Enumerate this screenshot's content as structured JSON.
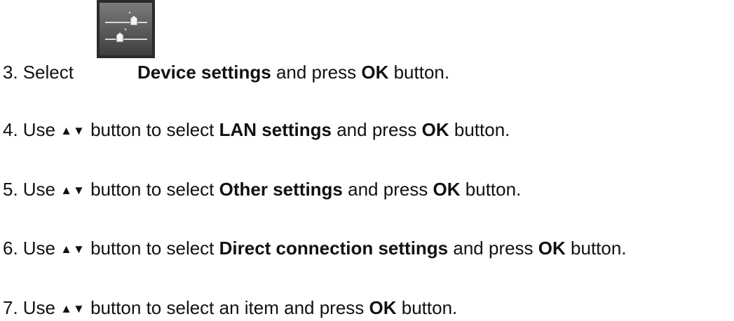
{
  "steps": [
    {
      "number": "3.",
      "pre": "Select",
      "icon": "device-settings-icon",
      "bold1": "Device settings",
      "mid": "and press",
      "bold2": "OK",
      "post": "button."
    },
    {
      "number": "4.",
      "pre": "Use",
      "arrows": "▲▼",
      "mid1": "button to select",
      "bold1": "LAN settings",
      "mid2": "and press",
      "bold2": "OK",
      "post": "button."
    },
    {
      "number": "5.",
      "pre": "Use",
      "arrows": "▲▼",
      "mid1": "button to select",
      "bold1": "Other settings",
      "mid2": "and press",
      "bold2": "OK",
      "post": "button."
    },
    {
      "number": "6.",
      "pre": "Use",
      "arrows": "▲▼",
      "mid1": "button to select",
      "bold1": "Direct connection settings",
      "mid2": "and press",
      "bold2": "OK",
      "post": "button."
    },
    {
      "number": "7.",
      "pre": "Use",
      "arrows": "▲▼",
      "mid1": "button to select an item and press",
      "bold2": "OK",
      "post": "button."
    }
  ],
  "colors": {
    "text": "#111111",
    "icon_bg": "#5a5a5a"
  }
}
